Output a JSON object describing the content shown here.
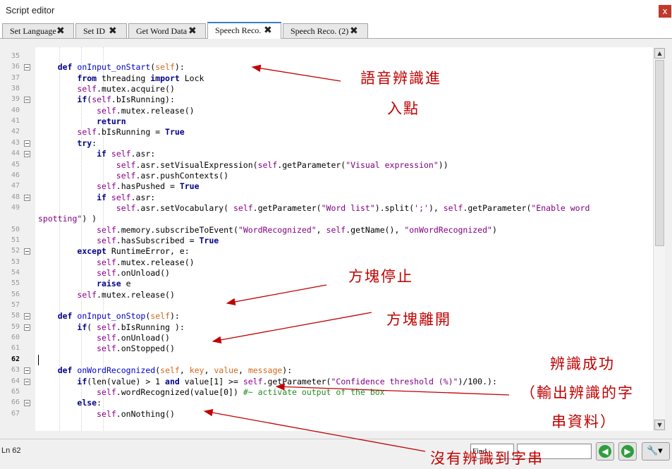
{
  "window": {
    "title": "Script editor",
    "close_glyph": "x"
  },
  "tabs": [
    {
      "label": "Set Language",
      "active": false
    },
    {
      "label": "Set ID",
      "active": false
    },
    {
      "label": "Get Word Data",
      "active": false
    },
    {
      "label": "Speech Reco.",
      "active": true
    },
    {
      "label": "Speech Reco. (2)",
      "active": false
    }
  ],
  "tab_close_glyph": "✖",
  "editor": {
    "current_line": "62",
    "lines": [
      {
        "n": "35",
        "fold": false,
        "html": ""
      },
      {
        "n": "36",
        "fold": true,
        "html": "    <span class='k'>def</span> <span class='f'>onInput_onStart</span>(<span class='p'>self</span>):"
      },
      {
        "n": "37",
        "fold": false,
        "html": "        <span class='k'>from</span> threading <span class='k'>import</span> Lock"
      },
      {
        "n": "38",
        "fold": false,
        "html": "        <span class='s'>self</span>.mutex.acquire()"
      },
      {
        "n": "39",
        "fold": true,
        "html": "        <span class='k'>if</span>(<span class='s'>self</span>.bIsRunning):"
      },
      {
        "n": "40",
        "fold": false,
        "html": "            <span class='s'>self</span>.mutex.release()"
      },
      {
        "n": "41",
        "fold": false,
        "html": "            <span class='k'>return</span>"
      },
      {
        "n": "42",
        "fold": false,
        "html": "        <span class='s'>self</span>.bIsRunning = <span class='k'>True</span>"
      },
      {
        "n": "43",
        "fold": true,
        "html": "        <span class='k'>try</span>:"
      },
      {
        "n": "44",
        "fold": true,
        "html": "            <span class='k'>if</span> <span class='s'>self</span>.asr:"
      },
      {
        "n": "45",
        "fold": false,
        "html": "                <span class='s'>self</span>.asr.setVisualExpression(<span class='s'>self</span>.getParameter(<span class='st'>\"Visual expression\"</span>))"
      },
      {
        "n": "46",
        "fold": false,
        "html": "                <span class='s'>self</span>.asr.pushContexts()"
      },
      {
        "n": "47",
        "fold": false,
        "html": "            <span class='s'>self</span>.hasPushed = <span class='k'>True</span>"
      },
      {
        "n": "48",
        "fold": true,
        "html": "            <span class='k'>if</span> <span class='s'>self</span>.asr:"
      },
      {
        "n": "49",
        "fold": false,
        "html": "                <span class='s'>self</span>.asr.setVocabulary( <span class='s'>self</span>.getParameter(<span class='st'>\"Word list\"</span>).split(<span class='st'>';'</span>), <span class='s'>self</span>.getParameter(<span class='st'>\"Enable word</span>"
      },
      {
        "n": "",
        "fold": false,
        "html": "<span class='st'>spotting\"</span>) )"
      },
      {
        "n": "50",
        "fold": false,
        "html": "            <span class='s'>self</span>.memory.subscribeToEvent(<span class='st'>\"WordRecognized\"</span>, <span class='s'>self</span>.getName(), <span class='st'>\"onWordRecognized\"</span>)"
      },
      {
        "n": "51",
        "fold": false,
        "html": "            <span class='s'>self</span>.hasSubscribed = <span class='k'>True</span>"
      },
      {
        "n": "52",
        "fold": true,
        "html": "        <span class='k'>except</span> RuntimeError, e:"
      },
      {
        "n": "53",
        "fold": false,
        "html": "            <span class='s'>self</span>.mutex.release()"
      },
      {
        "n": "54",
        "fold": false,
        "html": "            <span class='s'>self</span>.onUnload()"
      },
      {
        "n": "55",
        "fold": false,
        "html": "            <span class='k'>raise</span> e"
      },
      {
        "n": "56",
        "fold": false,
        "html": "        <span class='s'>self</span>.mutex.release()"
      },
      {
        "n": "57",
        "fold": false,
        "html": ""
      },
      {
        "n": "58",
        "fold": true,
        "html": "    <span class='k'>def</span> <span class='f'>onInput_onStop</span>(<span class='p'>self</span>):"
      },
      {
        "n": "59",
        "fold": true,
        "html": "        <span class='k'>if</span>( <span class='s'>self</span>.bIsRunning ):"
      },
      {
        "n": "60",
        "fold": false,
        "html": "            <span class='s'>self</span>.onUnload()"
      },
      {
        "n": "61",
        "fold": false,
        "html": "            <span class='s'>self</span>.onStopped()"
      },
      {
        "n": "62",
        "fold": false,
        "html": ""
      },
      {
        "n": "63",
        "fold": true,
        "html": "    <span class='k'>def</span> <span class='f'>onWordRecognized</span>(<span class='p'>self</span>, <span class='p'>key</span>, <span class='p'>value</span>, <span class='p'>message</span>):"
      },
      {
        "n": "64",
        "fold": true,
        "html": "        <span class='k'>if</span>(len(value) &gt; 1 <span class='k'>and</span> value[1] &gt;= <span class='s'>self</span>.getParameter(<span class='st'>\"Confidence threshold (%)\"</span>)/100.):"
      },
      {
        "n": "65",
        "fold": false,
        "html": "            <span class='s'>self</span>.wordRecognized(value[0]) <span class='c'>#~ activate output of the box</span>"
      },
      {
        "n": "66",
        "fold": true,
        "html": "        <span class='k'>else</span>:"
      },
      {
        "n": "67",
        "fold": false,
        "html": "            <span class='s'>self</span>.onNothing()"
      }
    ]
  },
  "status": {
    "line_label": "Ln 62",
    "find_option": "Find",
    "find_value": "",
    "prev_glyph": "◀",
    "next_glyph": "▶",
    "settings_glyph": "🔧▾"
  },
  "annotations": {
    "a1_line1": "語音辨識進",
    "a1_line2": "入點",
    "a2": "方塊停止",
    "a3": "方塊離開",
    "a4_line1": "辨識成功",
    "a4_line2": "（輸出辨識的字",
    "a4_line3": "串資料）",
    "a5": "沒有辨識到字串"
  },
  "colors": {
    "annotation": "#c00000",
    "keyword": "#00008b",
    "self": "#8b008b",
    "string": "#800080",
    "comment": "#228b22"
  }
}
